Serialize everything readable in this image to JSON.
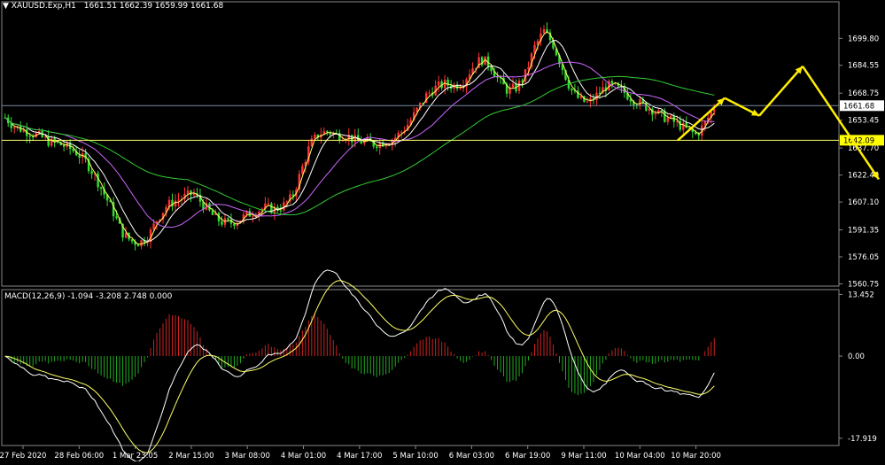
{
  "header": {
    "symbol": "XAUUSD.Exp,H1",
    "ohlc": "1661.51 1662.39 1659.99 1661.68"
  },
  "macd_header": "MACD(12,26,9) -1.094 -3.208 2.748 0.000",
  "chart_data": [
    {
      "type": "candlestick",
      "title": "XAUUSD.Exp,H1",
      "y_ticks": [
        1699.8,
        1684.55,
        1668.75,
        1653.45,
        1637.7,
        1622.4,
        1607.1,
        1591.35,
        1576.05,
        1560.75
      ],
      "ylim": [
        1559.5,
        1713.5
      ],
      "x_ticks": [
        "27 Feb 2020",
        "28 Feb 06:00",
        "1 Mar 23:05",
        "2 Mar 15:00",
        "3 Mar 08:00",
        "4 Mar 01:00",
        "4 Mar 17:00",
        "5 Mar 10:00",
        "6 Mar 03:00",
        "6 Mar 19:00",
        "9 Mar 11:00",
        "10 Mar 04:00",
        "10 Mar 20:00"
      ],
      "current_price_label": "1661.68",
      "current_price": 1661.68,
      "support_label": "1642.09",
      "support_level": 1642.09,
      "close_path": [
        1655,
        1650,
        1648,
        1646,
        1644,
        1641,
        1640,
        1638,
        1635,
        1630,
        1622,
        1612,
        1602,
        1590,
        1585,
        1584,
        1588,
        1598,
        1605,
        1608,
        1610,
        1612,
        1606,
        1600,
        1596,
        1595,
        1597,
        1600,
        1602,
        1604,
        1603,
        1605,
        1610,
        1625,
        1640,
        1646,
        1647,
        1645,
        1645,
        1642,
        1641,
        1640,
        1641,
        1642,
        1646,
        1652,
        1660,
        1668,
        1672,
        1674,
        1673,
        1675,
        1683,
        1688,
        1685,
        1676,
        1670,
        1672,
        1680,
        1695,
        1704,
        1697,
        1684,
        1671,
        1665,
        1663,
        1668,
        1673,
        1672,
        1669,
        1665,
        1662,
        1660,
        1656,
        1654,
        1651,
        1648,
        1645,
        1652,
        1661
      ],
      "series": [
        {
          "name": "",
          "color": "#ffff66",
          "kind": "fast-ma"
        },
        {
          "name": "",
          "color": "#ffffff",
          "kind": "ma"
        },
        {
          "name": "",
          "color": "#cc66ff",
          "kind": "ma"
        },
        {
          "name": "",
          "color": "#33cc33",
          "kind": "slow-ma"
        }
      ],
      "forecast_arrow": {
        "color": "#ffee00",
        "points": [
          [
            1642,
            0
          ],
          [
            1666,
            1
          ],
          [
            1656,
            2
          ],
          [
            1684,
            3
          ],
          [
            1620,
            4
          ]
        ]
      }
    },
    {
      "type": "bar",
      "title": "MACD(12,26,9) -1.094 -3.208 2.748 0.000",
      "y_ticks": [
        13.452,
        0.0,
        -17.919
      ],
      "ylim": [
        -19.5,
        14.5
      ],
      "colors": {
        "positive": "#cc2222",
        "negative": "#22aa22",
        "macd_line": "#ffffff",
        "signal_line": "#ffff66"
      }
    }
  ]
}
